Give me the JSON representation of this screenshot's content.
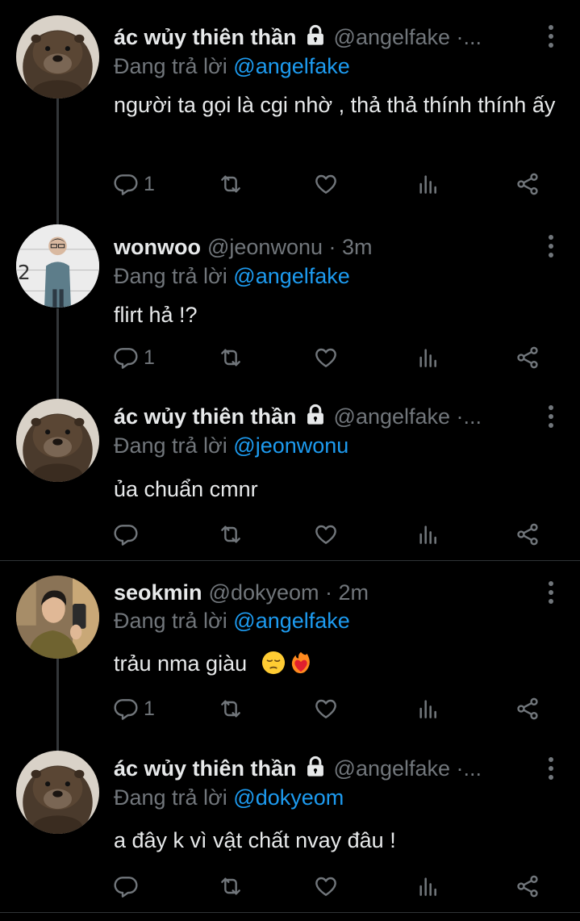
{
  "tweets": [
    {
      "name": "ác wủy thiên thần",
      "protected": true,
      "handle_time": "@angelfake ·...",
      "replying_prefix": "Đang trả lời",
      "replying_to": "@angelfake",
      "text": "người ta gọi là cgi nhờ , thả thả thính thính ấy",
      "reply_count": "1",
      "avatar": "otter"
    },
    {
      "name": "wonwoo",
      "protected": false,
      "handle_time": "@jeonwonu · 3m",
      "replying_prefix": "Đang trả lời",
      "replying_to": "@angelfake",
      "text": "flirt hả !?",
      "reply_count": "1",
      "avatar": "person-lineup"
    },
    {
      "name": "ác wủy thiên thần",
      "protected": true,
      "handle_time": "@angelfake ·...",
      "replying_prefix": "Đang trả lời",
      "replying_to": "@jeonwonu",
      "text": "ủa chuẩn cmnr",
      "reply_count": "",
      "avatar": "otter"
    },
    {
      "name": "seokmin",
      "protected": false,
      "handle_time": "@dokyeom · 2m",
      "replying_prefix": "Đang trả lời",
      "replying_to": "@angelfake",
      "text": "trảu nma giàu",
      "emojis": [
        "pensive-face",
        "heart-on-fire"
      ],
      "reply_count": "1",
      "avatar": "person-selfie"
    },
    {
      "name": "ác wủy thiên thần",
      "protected": true,
      "handle_time": "@angelfake ·...",
      "replying_prefix": "Đang trả lời",
      "replying_to": "@dokyeom",
      "text": "a đây k vì vật chất nvay đâu !",
      "reply_count": "",
      "avatar": "otter"
    }
  ],
  "colors": {
    "background": "#000000",
    "text": "#e7e9ea",
    "secondary": "#71767b",
    "accent": "#1d9bf0",
    "line": "#333639"
  }
}
